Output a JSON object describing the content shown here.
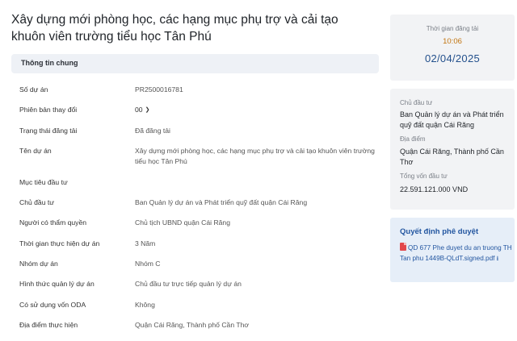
{
  "page": {
    "title": "Xây dựng mới phòng học, các hạng mục phụ trợ và cải tạo khuôn viên trường tiểu học Tân Phú"
  },
  "general_section": {
    "heading": "Thông tin chung",
    "rows": [
      {
        "label": "Số dự án",
        "value": "PR2500016781"
      },
      {
        "label": "Phiên bản thay đổi",
        "value": "00"
      },
      {
        "label": "Trạng thái đăng tải",
        "value": "Đã đăng tải"
      },
      {
        "label": "Tên dự án",
        "value": "Xây dựng mới phòng học, các hạng mục phụ trợ và cải tạo khuôn viên trường tiểu học Tân Phú"
      },
      {
        "label": "Mục tiêu đầu tư",
        "value": ""
      },
      {
        "label": "Chủ đầu tư",
        "value": "Ban Quản lý dự án và Phát triển quỹ đất quận Cái Răng"
      },
      {
        "label": "Người có thẩm quyền",
        "value": "Chủ tịch UBND quận Cái Răng"
      },
      {
        "label": "Thời gian thực hiện dự án",
        "value": "3 Năm"
      },
      {
        "label": "Nhóm dự án",
        "value": "Nhóm C"
      },
      {
        "label": "Hình thức quản lý dự án",
        "value": "Chủ đầu tư trực tiếp quản lý dự án"
      },
      {
        "label": "Có sử dụng vốn ODA",
        "value": "Không"
      },
      {
        "label": "Địa điểm thực hiện",
        "value": "Quận Cái Răng, Thành phố Cần Thơ"
      }
    ]
  },
  "publish_card": {
    "label": "Thời gian đăng tải",
    "time": "10:06",
    "date": "02/04/2025"
  },
  "info_card": {
    "owner_label": "Chủ đầu tư",
    "owner_value": "Ban Quản lý dự án và Phát triển quỹ đất quận Cái Răng",
    "location_label": "Địa điểm",
    "location_value": "Quận Cái Răng, Thành phố Cần Thơ",
    "capital_label": "Tổng vốn đầu tư",
    "capital_value": "22.591.121.000 VND"
  },
  "decision_card": {
    "title": "Quyết định phê duyệt",
    "file_name": "QD 677 Phe duyet du an truong TH Tan phu 1449B-QLdT.signed.pdf",
    "file_icon": "pdf-file-icon",
    "download_icon": "download-icon"
  },
  "colors": {
    "accent_blue": "#23508c",
    "time_orange": "#c2740f",
    "pdf_red": "#e2474b"
  }
}
